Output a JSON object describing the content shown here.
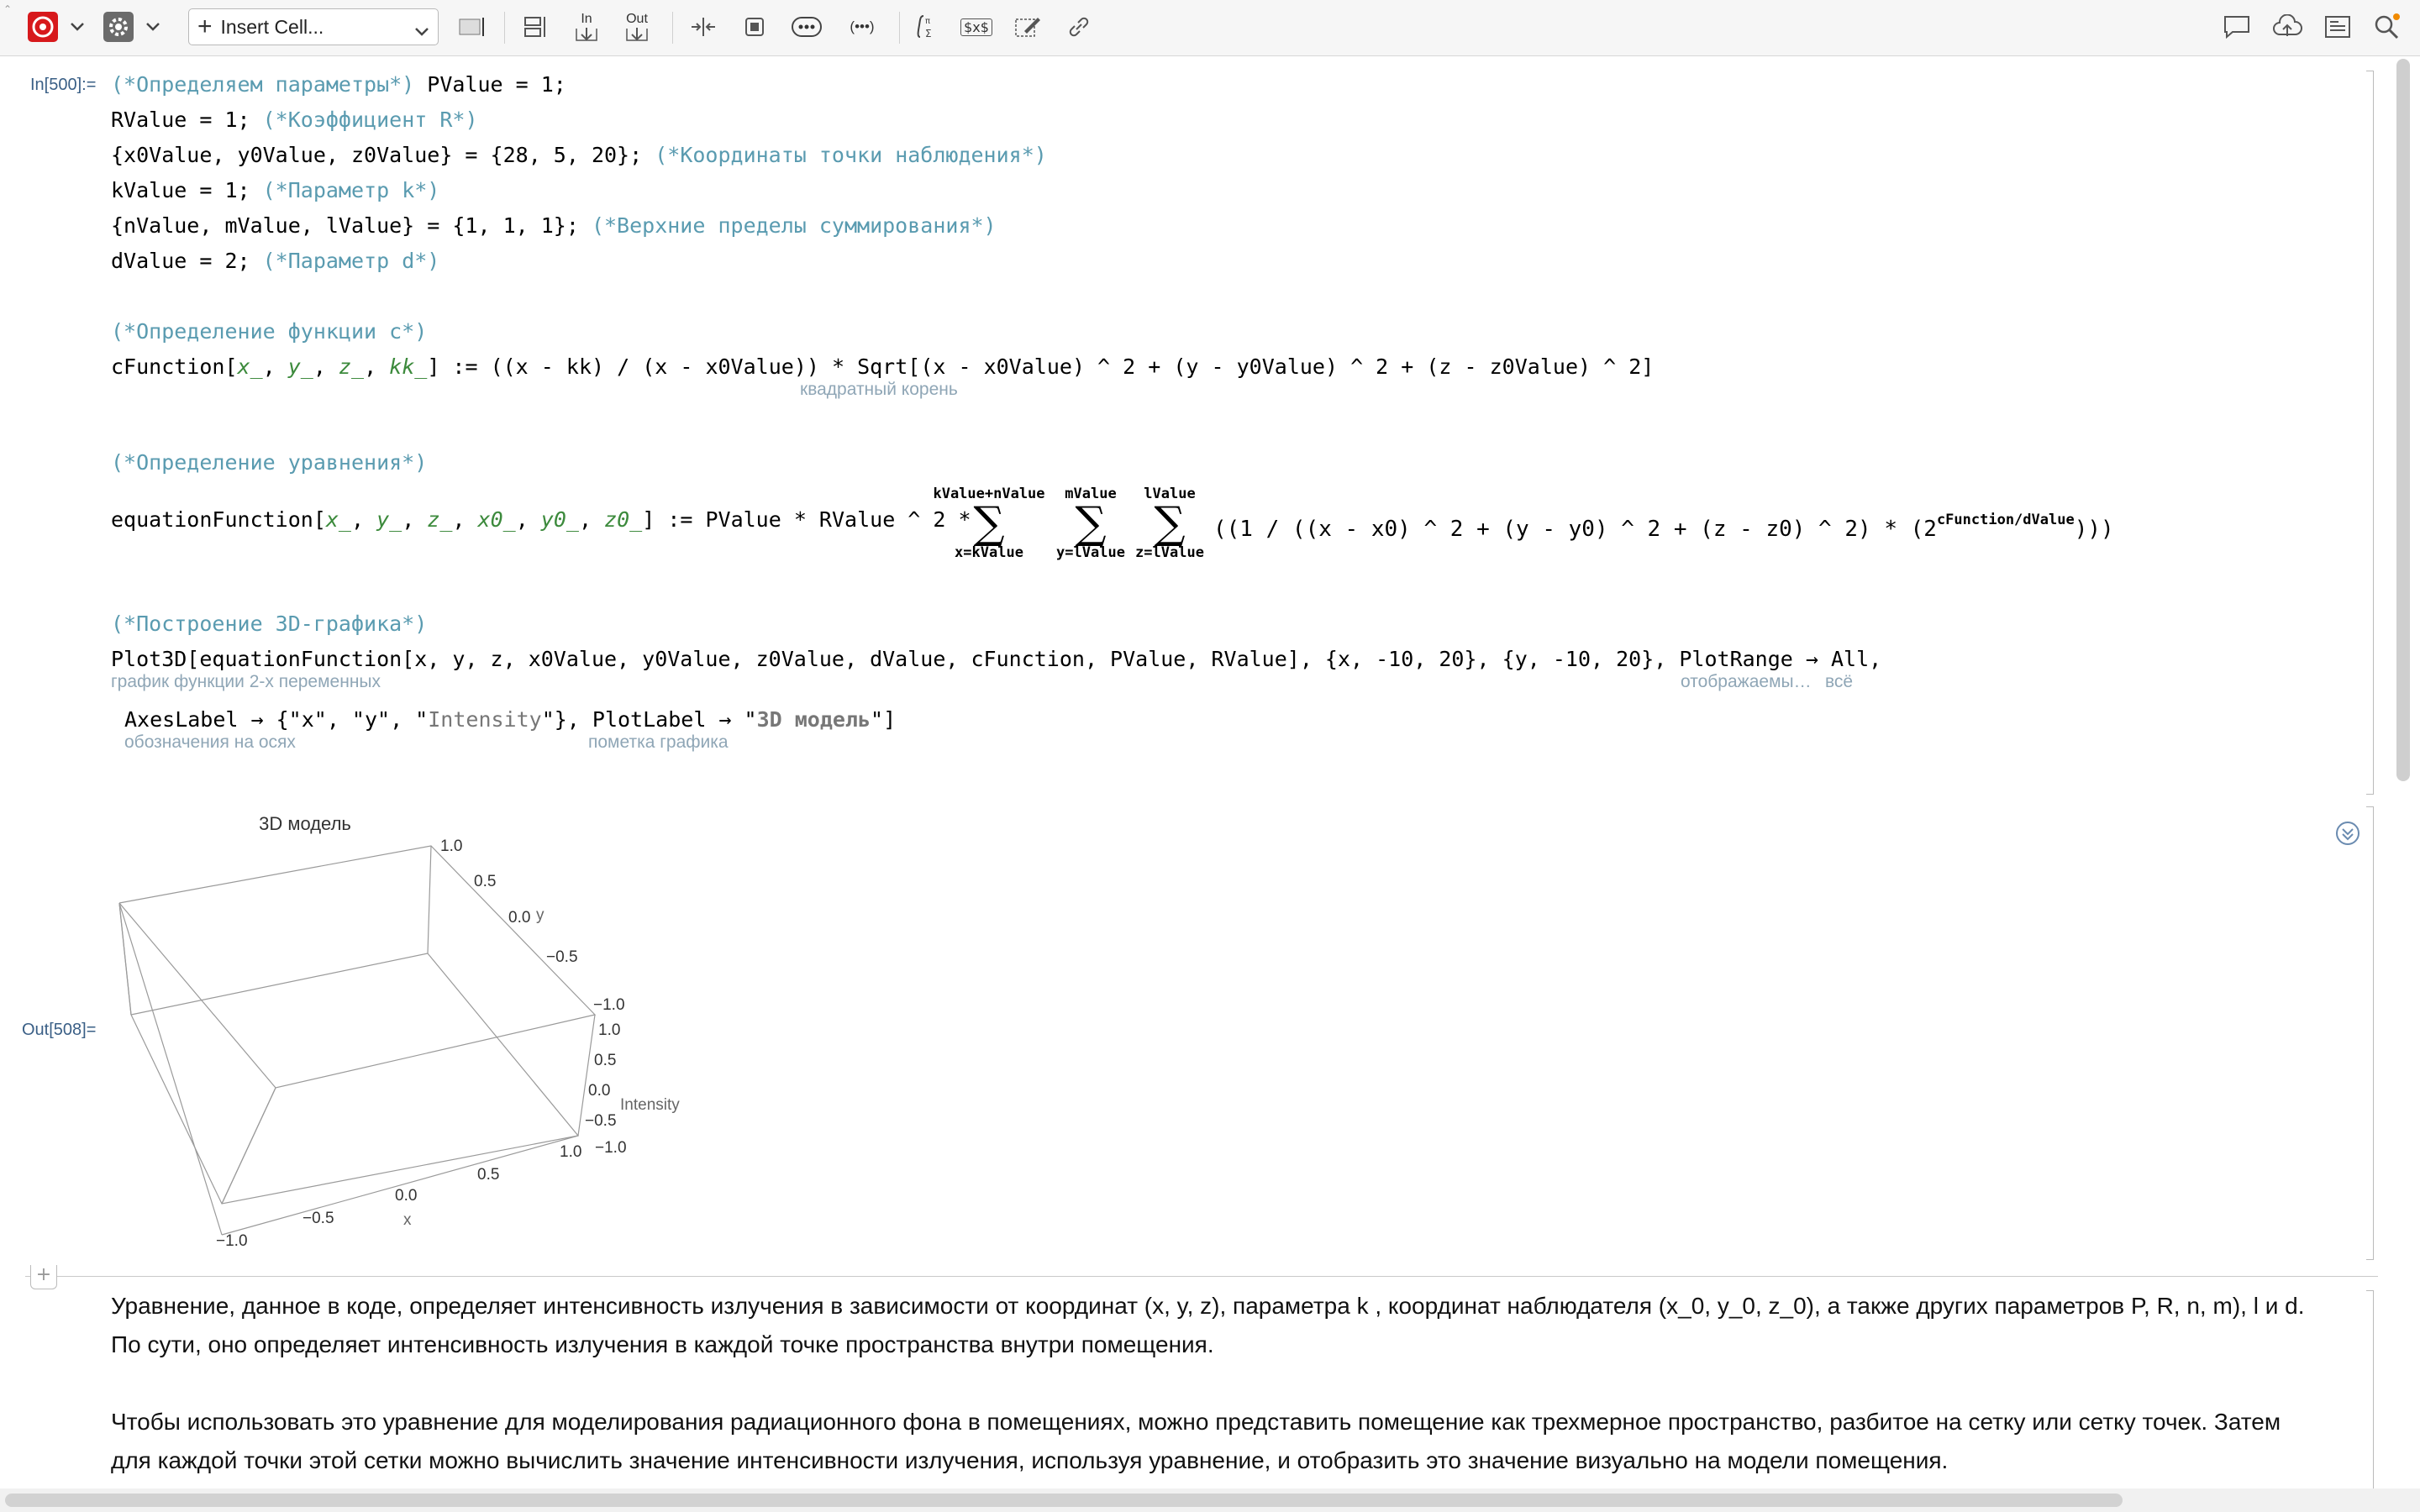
{
  "toolbar": {
    "insert_cell_label": "Insert Cell...",
    "in_label": "In",
    "out_label": "Out",
    "ellipsis": "•••",
    "dots_button": "(•••)",
    "tex_label": "$x$"
  },
  "cells": {
    "input_label": "In[500]:=",
    "output_label": "Out[508]="
  },
  "code": {
    "l1_comment": "(*Определяем параметры*)",
    "l1_code": "PValue = 1;",
    "l2_code": "RValue = 1; ",
    "l2_comment": "(*Коэффициент R*)",
    "l3_code": "{x0Value, y0Value, z0Value} = {28, 5, 20}; ",
    "l3_comment": "(*Координаты точки наблюдения*)",
    "l4_code": "kValue = 1; ",
    "l4_comment": "(*Параметр k*)",
    "l5_code": "{nValue, mValue, lValue} = {1, 1, 1}; ",
    "l5_comment": "(*Верхние пределы суммирования*)",
    "l6_code": "dValue = 2; ",
    "l6_comment": "(*Параметр d*)",
    "l7_comment": "(*Определение функции c*)",
    "l8_head": "cFunction[",
    "l8_tail": "] := ((x - kk) / (x - x0Value)) * Sqrt[(x - x0Value) ^ 2 + (y - y0Value) ^ 2 + (z - z0Value) ^ 2]",
    "l8_hint": "квадратный корень",
    "l9_comment": "(*Определение уравнения*)",
    "l10_head": "equationFunction[",
    "l10_mid": "] := PValue * RValue ^ 2 *",
    "l10_tail": "((1 / ((x - x0) ^ 2 + (y - y0) ^ 2 + (z - z0) ^ 2) * (2",
    "l10_exp": "cFunction/dValue",
    "l10_close": ")))",
    "sum1_top": "kValue+nValue",
    "sum1_bottom": "x=kValue",
    "sum2_top": "mValue",
    "sum2_bottom": "y=lValue",
    "sum3_top": "lValue",
    "sum3_bottom": "z=lValue",
    "sigma": "∑",
    "l11_comment": "(*Построение 3D-графика*)",
    "l12": "Plot3D[equationFunction[x, y, z, x0Value, y0Value, z0Value, dValue, cFunction, PValue, RValue], {x, -10, 20}, {y, -10, 20}, PlotRange → All,",
    "l12_hint1": "график функции 2-х переменных",
    "l12_hint2": "отображаемы…",
    "l12_hint3": "всё",
    "l13_a": "AxesLabel → {\"x\", \"y\", \"",
    "l13_intensity": "Intensity",
    "l13_b": "\"}, PlotLabel → \"",
    "l13_model": "3D модель",
    "l13_c": "\"]",
    "l13_hint1": "обозначения на осях",
    "l13_hint2": "пометка графика"
  },
  "plot": {
    "title": "3D модель",
    "y_ticks": [
      "1.0",
      "0.5",
      "0.0",
      "−0.5",
      "−1.0"
    ],
    "y_label": "y",
    "z_ticks": [
      "1.0",
      "0.5",
      "0.0",
      "−0.5",
      "−1.0"
    ],
    "z_label": "Intensity",
    "x_ticks": [
      "1.0",
      "0.5",
      "0.0",
      "−0.5",
      "−1.0"
    ],
    "x_label": "x"
  },
  "text": {
    "p1_line1": "Уравнение, данное в коде, определяет интенсивность излучения в зависимости от координат (x, y, z), параметра  k , координат наблюдателя (x_0, y_0, z_0), а также других параметров  P, R, n, m),  l и d.",
    "p1_line2": "По сути, оно определяет интенсивность излучения в каждой точке пространства внутри помещения.",
    "p2_line1": "Чтобы использовать это уравнение для моделирования радиационного фона в помещениях, можно представить помещение как трехмерное пространство, разбитое на сетку или сетку точек. Затем",
    "p2_line2": "для каждой точки этой сетки можно вычислить значение интенсивности излучения, используя уравнение, и отобразить это значение визуально на модели помещения."
  },
  "colors": {
    "comment": "#5a9bb0",
    "pattern_var": "#3c8a3c",
    "local_var": "#1d3fc4",
    "hint": "#8fa6b6",
    "cell_label": "#3a5f86"
  }
}
